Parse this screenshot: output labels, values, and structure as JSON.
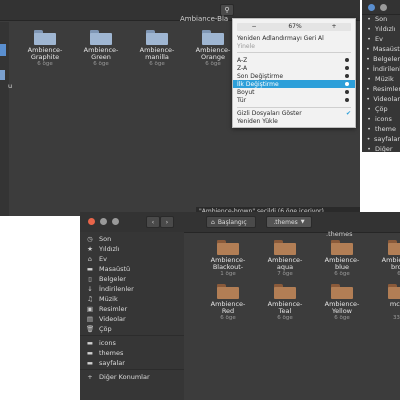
{
  "bg_window": {
    "title": "Ambiance-Bla",
    "folders": [
      {
        "name": "Ambience-\nGraphite",
        "count": "6 öge"
      },
      {
        "name": "Ambience-\nGreen",
        "count": "6 öge"
      },
      {
        "name": "Ambience-\nmanilla",
        "count": "6 öge"
      },
      {
        "name": "Ambience-\nOrange",
        "count": "6 öge"
      }
    ],
    "partial_label": "u",
    "status": "\"Ambience-brown\" seçildi (6 öge içeriyor)",
    "colors": {
      "folder_top": "#7f96b4",
      "folder_body": "#9fb6d2"
    }
  },
  "menu": {
    "zoom": "67%",
    "minus_label": "−",
    "plus_label": "+",
    "undo_label": "Yeniden Adlandırmayı Geri Al",
    "redo_label": "Yinele",
    "sort": [
      "A-Z",
      "Z-A",
      "Son Değiştirme",
      "İlk Değiştirme",
      "Boyut",
      "Tür"
    ],
    "sort_selected": "İlk Değiştirme",
    "show_hidden": "Gizli Dosyaları Göster",
    "reload": "Yeniden Yükle",
    "colors": {
      "highlight": "#2d9fd9"
    }
  },
  "right_window": {
    "sidebar": [
      "Son",
      "Yıldızlı",
      "Ev",
      "Masaüstü",
      "Belgeler",
      "İndirilenler",
      "Müzik",
      "Resimler",
      "Videolar",
      "Çöp",
      "icons",
      "theme",
      "sayfalar",
      "Diğer"
    ]
  },
  "main_window": {
    "breadcrumb": {
      "start": "Başlangıç",
      "current": ".themes"
    },
    "header_title": ".themes",
    "sidebar": [
      {
        "icon": "clock-icon",
        "glyph": "◷",
        "label": "Son"
      },
      {
        "icon": "star-icon",
        "glyph": "★",
        "label": "Yıldızlı"
      },
      {
        "icon": "home-icon",
        "glyph": "⌂",
        "label": "Ev"
      },
      {
        "icon": "folder-icon",
        "glyph": "▬",
        "label": "Masaüstü"
      },
      {
        "icon": "document-icon",
        "glyph": "▯",
        "label": "Belgeler"
      },
      {
        "icon": "download-icon",
        "glyph": "↓",
        "label": "İndirilenler"
      },
      {
        "icon": "music-icon",
        "glyph": "♫",
        "label": "Müzik"
      },
      {
        "icon": "picture-icon",
        "glyph": "▣",
        "label": "Resimler"
      },
      {
        "icon": "video-icon",
        "glyph": "▤",
        "label": "Videolar"
      },
      {
        "icon": "trash-icon",
        "glyph": "🗑",
        "label": "Çöp"
      },
      {
        "icon": "folder-icon",
        "glyph": "▬",
        "label": "icons"
      },
      {
        "icon": "folder-icon",
        "glyph": "▬",
        "label": "themes"
      },
      {
        "icon": "folder-icon",
        "glyph": "▬",
        "label": "sayfalar"
      },
      {
        "icon": "plus-icon",
        "glyph": "+",
        "label": "Diğer Konumlar"
      }
    ],
    "folders": [
      {
        "name": "Ambience-\nBlackout-",
        "count": "1 öge"
      },
      {
        "name": "Ambience-\naqua",
        "count": "7 öge"
      },
      {
        "name": "Ambience-\nblue",
        "count": "6 öge"
      },
      {
        "name": "Ambience-\nbrow",
        "count": "6"
      },
      {
        "name": "Ambience-\nRed",
        "count": "6 öge"
      },
      {
        "name": "Ambience-\nTeal",
        "count": "6 öge"
      },
      {
        "name": "Ambience-\nYellow",
        "count": "6 öge"
      },
      {
        "name": "mcbu",
        "count": "33 ö"
      }
    ],
    "colors": {
      "folder_top": "#8a5a3a",
      "folder_body": "#b27e55"
    }
  }
}
